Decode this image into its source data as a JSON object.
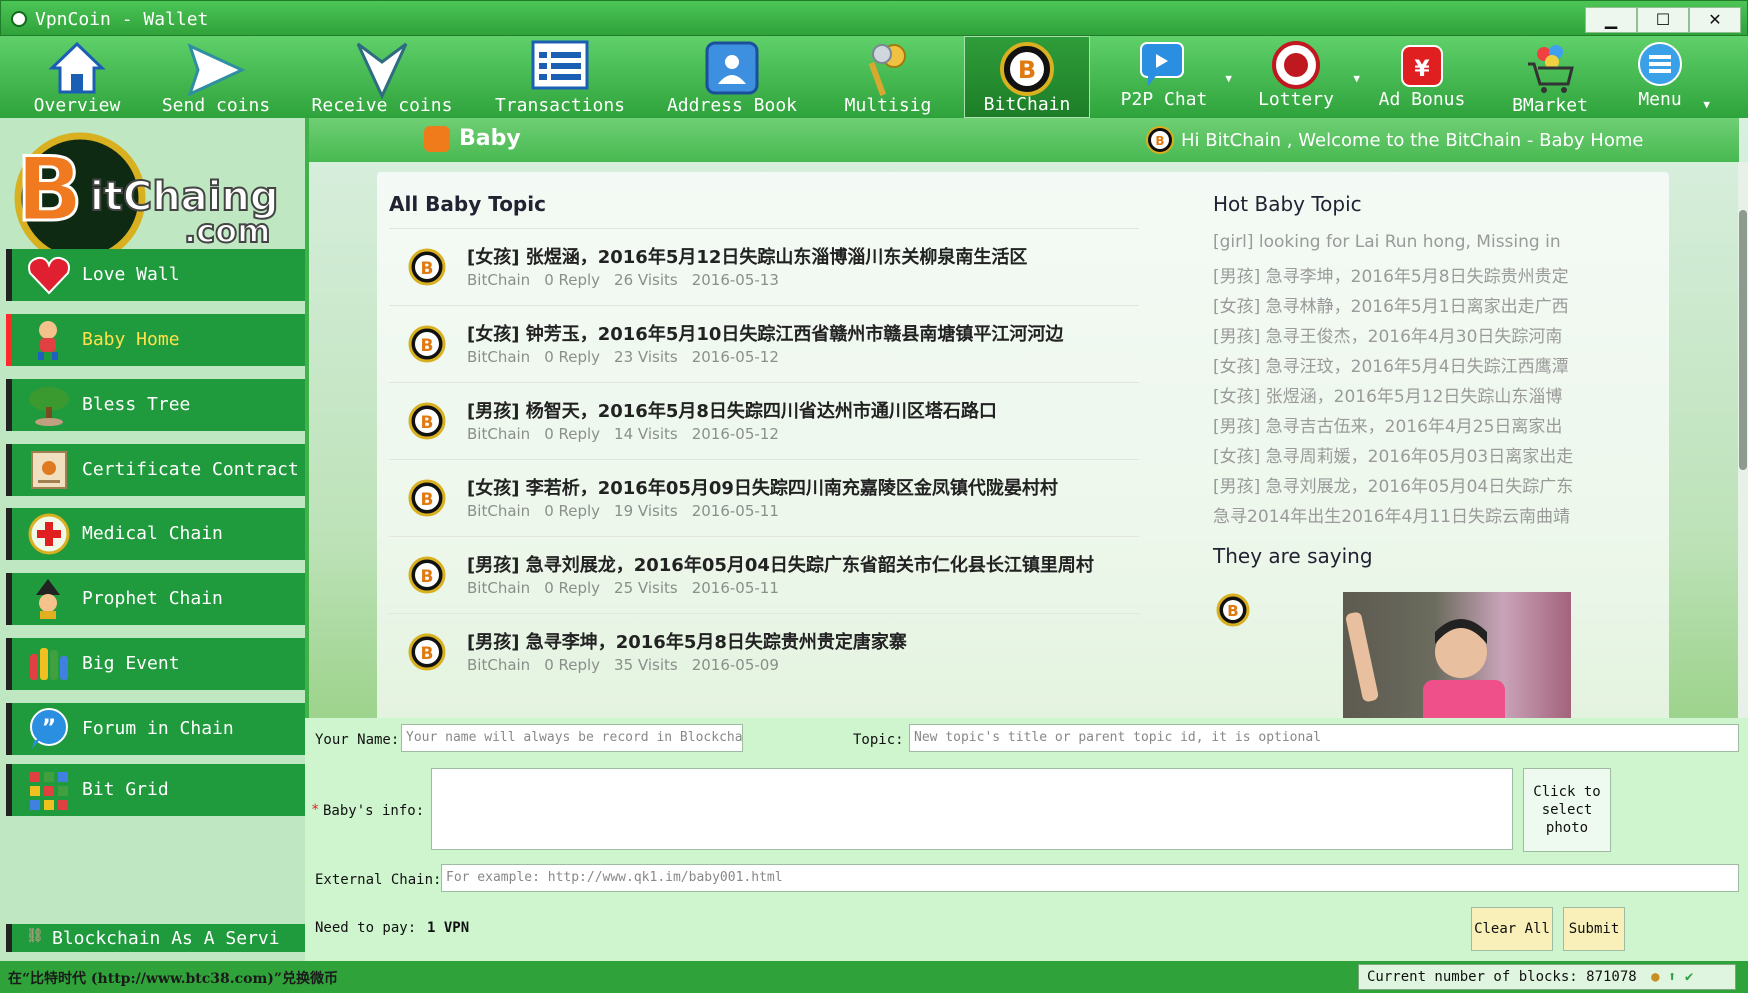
{
  "window": {
    "title": "VpnCoin - Wallet",
    "minimize": "▁",
    "maximize": "☐",
    "close": "✕"
  },
  "toolbar": {
    "items": [
      {
        "label": "Overview",
        "icon": "home-icon"
      },
      {
        "label": "Send coins",
        "icon": "send-icon"
      },
      {
        "label": "Receive coins",
        "icon": "receive-icon"
      },
      {
        "label": "Transactions",
        "icon": "list-icon"
      },
      {
        "label": "Address Book",
        "icon": "contact-icon"
      },
      {
        "label": "Multisig",
        "icon": "keys-icon"
      },
      {
        "label": "BitChain",
        "icon": "bitchain-icon"
      },
      {
        "label": "P2P Chat",
        "icon": "chat-icon"
      },
      {
        "label": "Lottery",
        "icon": "lottery-icon"
      },
      {
        "label": "Ad Bonus",
        "icon": "bonus-icon"
      },
      {
        "label": "BMarket",
        "icon": "cart-icon"
      },
      {
        "label": "Menu",
        "icon": "menu-icon"
      }
    ]
  },
  "sidebar": {
    "logo_text": "BitChaing.com",
    "items": [
      {
        "label": "Love Wall"
      },
      {
        "label": "Baby Home"
      },
      {
        "label": "Bless Tree"
      },
      {
        "label": "Certificate  Contract"
      },
      {
        "label": "Medical Chain"
      },
      {
        "label": "Prophet Chain"
      },
      {
        "label": "Big Event"
      },
      {
        "label": "Forum in Chain"
      },
      {
        "label": "Bit Grid"
      },
      {
        "label": "Blockchain As A Service"
      }
    ]
  },
  "content": {
    "tab_title": "Baby",
    "welcome": "Hi BitChain , Welcome to the BitChain - Baby Home",
    "all_title": "All Baby Topic",
    "topics": [
      {
        "title": "[女孩] 张煜涵，2016年5月12日失踪山东淄博淄川东关柳泉南生活区",
        "author": "BitChain",
        "replies": "0 Reply",
        "visits": "26 Visits",
        "date": "2016-05-13"
      },
      {
        "title": "[女孩] 钟芳玉，2016年5月10日失踪江西省赣州市赣县南塘镇平江河河边",
        "author": "BitChain",
        "replies": "0 Reply",
        "visits": "23 Visits",
        "date": "2016-05-12"
      },
      {
        "title": "[男孩] 杨智天，2016年5月8日失踪四川省达州市通川区塔石路口",
        "author": "BitChain",
        "replies": "0 Reply",
        "visits": "14 Visits",
        "date": "2016-05-12"
      },
      {
        "title": "[女孩] 李若析，2016年05月09日失踪四川南充嘉陵区金凤镇代陇晏村村",
        "author": "BitChain",
        "replies": "0 Reply",
        "visits": "19 Visits",
        "date": "2016-05-11"
      },
      {
        "title": "[男孩] 急寻刘展龙，2016年05月04日失踪广东省韶关市仁化县长江镇里周村",
        "author": "BitChain",
        "replies": "0 Reply",
        "visits": "25 Visits",
        "date": "2016-05-11"
      },
      {
        "title": "[男孩] 急寻李坤，2016年5月8日失踪贵州贵定唐家寨",
        "author": "BitChain",
        "replies": "0 Reply",
        "visits": "35 Visits",
        "date": "2016-05-09"
      }
    ],
    "hot_title": "Hot Baby Topic",
    "hot_items": [
      "[girl] looking for Lai Run hong, Missing in",
      "[男孩] 急寻李坤，2016年5月8日失踪贵州贵定",
      "[女孩] 急寻林静，2016年5月1日离家出走广西",
      "[男孩] 急寻王俊杰，2016年4月30日失踪河南",
      "[女孩] 急寻汪玟，2016年5月4日失踪江西鹰潭",
      "[女孩] 张煜涵，2016年5月12日失踪山东淄博",
      "[男孩] 急寻吉古伍来，2016年4月25日离家出",
      "[女孩] 急寻周莉媛，2016年05月03日离家出走",
      "[男孩] 急寻刘展龙，2016年05月04日失踪广东",
      "急寻2014年出生2016年4月11日失踪云南曲靖"
    ],
    "saying_title": "They are saying"
  },
  "form": {
    "name_label": "Your Name:",
    "name_placeholder": "Your name will always be record in Blockchain",
    "topic_label": "Topic:",
    "topic_placeholder": "New topic's title or parent topic id, it is optional",
    "required_mark": "*",
    "info_label": "Baby's info:",
    "photo_button": "Click to select photo",
    "external_label": "External Chain:",
    "external_placeholder": "For example: http://www.qk1.im/baby001.html",
    "pay_label": "Need to pay:",
    "pay_value": "1 VPN",
    "clear_button": "Clear All",
    "submit_button": "Submit"
  },
  "status": {
    "left_text": "在“比特时代 (http://www.btc38.com)”兑换微币",
    "blocks_text": "Current number of blocks: 871078"
  }
}
